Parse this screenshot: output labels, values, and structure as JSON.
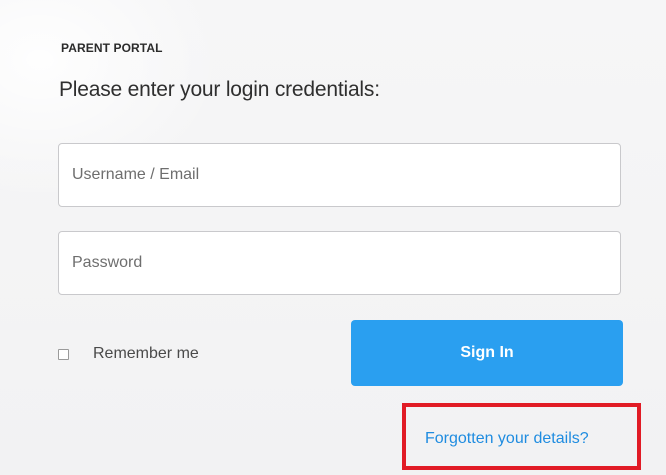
{
  "portal": {
    "eyebrow": "PARENT PORTAL",
    "heading": "Please enter your login credentials:"
  },
  "form": {
    "username_placeholder": "Username / Email",
    "password_placeholder": "Password",
    "remember_label": "Remember me",
    "remember_checked": false,
    "signin_label": "Sign In",
    "forgot_label": "Forgotten your details?"
  },
  "colors": {
    "accent": "#2a9ff0",
    "link": "#1f8ce0",
    "highlight": "#e11b25"
  }
}
